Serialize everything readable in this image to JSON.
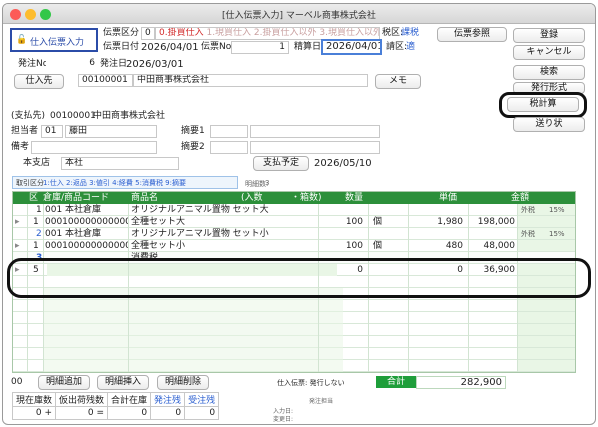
{
  "window": {
    "title": "[仕入伝票入力] マーベル商事株式会社"
  },
  "header": {
    "mode_label": "仕入伝票入力",
    "denpyo_kubun_label": "伝票区分",
    "denpyo_kubun_value": "0",
    "kubun_options_row1": "0.掛買仕入 1.現買仕入 2.掛買仕入以外 3.現買仕入以外",
    "kubun_selected": "0.掛買仕入",
    "zei_kubun_label": "税区:",
    "zei_kubun_value": "課税",
    "date_label": "伝票日付",
    "date_value": "2026/04/01",
    "denpyo_no_label": "伝票No",
    "denpyo_no_value": "1",
    "seisan_label": "精算日",
    "seisan_value": "2026/04/01",
    "seikyu_label": "請区:",
    "seikyu_value": "適",
    "hatchu_no_label": "発注No",
    "hatchu_no_value": "6",
    "hatchu_date_label": "発注日",
    "hatchu_date_value": "2026/03/01",
    "shiiresaki_label": "仕入先",
    "shiiresaki_code": "00100001",
    "shiiresaki_name": "中田商事株式会社",
    "memo_label": "メモ"
  },
  "side_buttons": {
    "denpyo_sansho": "伝票参照",
    "toroku": "登録",
    "cancel": "キャンセル",
    "kensaku": "検索",
    "hakko_keishiki": "発行形式",
    "zei_keisan": "税計算",
    "okurijo": "送り状"
  },
  "info": {
    "shiharai_label": "(支払先)",
    "shiharai_code": "00100001",
    "shiharai_name": "中田商事株式会社",
    "tanto_label": "担当者",
    "tanto_code": "01",
    "tanto_name": "藤田",
    "tekiyo1_label": "摘要1",
    "biko_label": "備考",
    "tekiyo2_label": "摘要2",
    "shiten_label": "本支店",
    "shiten_value": "本社",
    "shiharai_yotei_label": "支払予定",
    "shiharai_yotei_value": "2026/05/10",
    "torihiki_kubun_label": "取引区分",
    "torihiki_options": "1:仕入 2:返品 3:値引 4:経費 5:消費税 9:摘要",
    "meisai_label": "明細数:",
    "meisai_value": "3"
  },
  "grid": {
    "headers": {
      "ku": "区",
      "soko": "倉庫/商品コード",
      "shohin": "商品名",
      "irisu": "(入数",
      "hakosu": "・箱数)",
      "suryo": "数量",
      "tanka": "単価",
      "kingaku": "金額"
    },
    "rows": [
      {
        "no": "1",
        "soko_code": "001",
        "soko_name": "本社倉庫",
        "shohin_name": "オリジナルアニマル置物 セット大",
        "zei": "外税",
        "zei_rate": "15%",
        "kubun": "1",
        "shohin_code": "000100000000000",
        "shohin_short": "全種セット大",
        "suryo": "100",
        "tani": "個",
        "tanka": "1,980",
        "kingaku": "198,000"
      },
      {
        "no": "2",
        "soko_code": "001",
        "soko_name": "本社倉庫",
        "shohin_name": "オリジナルアニマル置物 セット小",
        "zei": "外税",
        "zei_rate": "15%",
        "kubun": "1",
        "shohin_code": "000100000000000",
        "shohin_short": "全種セット小",
        "suryo": "100",
        "tani": "個",
        "tanka": "480",
        "kingaku": "48,000"
      },
      {
        "no": "3",
        "shohin_name": "消費税",
        "kubun": "5",
        "suryo": "0",
        "tanka": "0",
        "kingaku": "36,900"
      }
    ]
  },
  "footer": {
    "count": "00",
    "add_row": "明細追加",
    "insert_row": "明細挿入",
    "delete_row": "明細削除",
    "hakko_status": "仕入伝票: 発行しない",
    "total_label": "合計",
    "total_value": "282,900",
    "stock_headers": [
      "現在庫数",
      "仮出荷残数",
      "合計在庫",
      "発注残",
      "受注残"
    ],
    "stock_values": [
      "0 +",
      "0 =",
      "0",
      "0",
      "0"
    ],
    "hatchu_tanto_label": "発注担当",
    "nyuryoku_label": "入力日:",
    "henko_label": "変更日:"
  },
  "colors": {
    "grid_header": "#2c8f3a",
    "total_label": "#1e9e3a",
    "mode_border": "#2b4ca8",
    "kubun_red": "#d22a2a",
    "accent_blue": "#2b5fd0"
  }
}
